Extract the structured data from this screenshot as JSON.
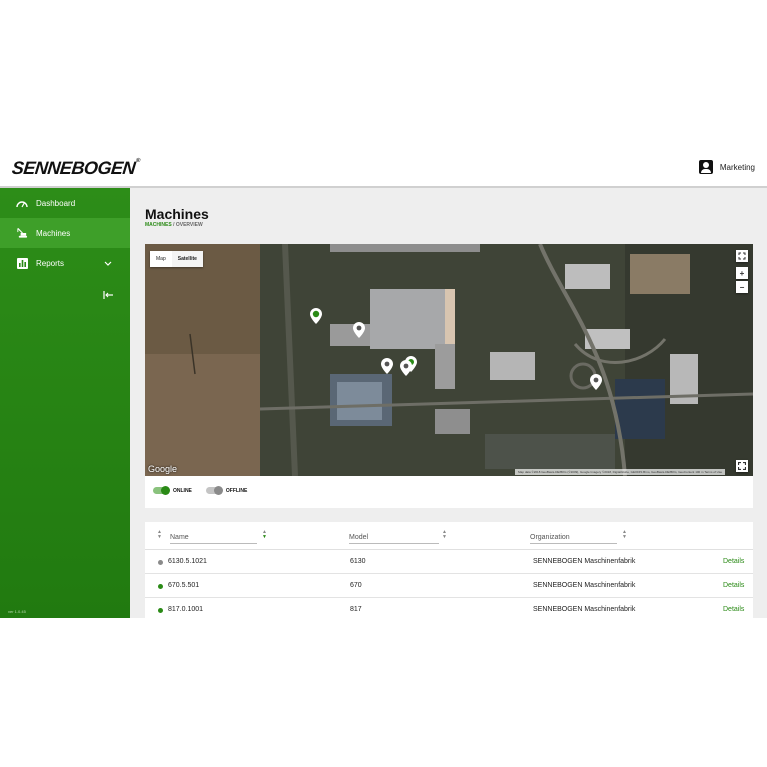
{
  "brand": {
    "logo_text": "SENNEBOGEN"
  },
  "user": {
    "name": "Marketing",
    "icon": "user-account-icon"
  },
  "sidebar": {
    "items": [
      {
        "label": "Dashboard",
        "icon": "dashboard-gauge-icon",
        "active": false
      },
      {
        "label": "Machines",
        "icon": "crane-machine-icon",
        "active": true
      },
      {
        "label": "Reports",
        "icon": "bar-chart-icon",
        "active": false
      }
    ],
    "collapse_icon": "collapse-left-icon",
    "version": "ver 1.0.45"
  },
  "page": {
    "title": "Machines",
    "breadcrumb": {
      "first": "MACHINES",
      "separator": "/",
      "second": "OVERVIEW"
    }
  },
  "map": {
    "types": [
      "Map",
      "Satellite"
    ],
    "selected_type": "Satellite",
    "zoom_in": "+",
    "zoom_out": "−",
    "google_label": "Google",
    "attribution": "Map data ©2018 GeoBasis-DE/BKG (©2009), Google Imagery ©2018, DigitalGlobe, GEODIS Brno, GeoBasis-DE/BKG, GeoContent   100 m   Terms of Use"
  },
  "legend": {
    "online_label": "ONLINE",
    "offline_label": "OFFLINE",
    "online_color": "#2a8a16",
    "offline_color": "#8a8a8a"
  },
  "table": {
    "columns": [
      "Name",
      "Model",
      "Organization"
    ],
    "rows": [
      {
        "name": "6130.5.1021",
        "model": "6130",
        "organization": "SENNEBOGEN Maschinenfabrik",
        "action": "Details",
        "status": "offline"
      },
      {
        "name": "670.5.501",
        "model": "670",
        "organization": "SENNEBOGEN Maschinenfabrik",
        "action": "Details",
        "status": "online"
      },
      {
        "name": "817.0.1001",
        "model": "817",
        "organization": "SENNEBOGEN Maschinenfabrik",
        "action": "Details",
        "status": "online"
      }
    ]
  },
  "colors": {
    "brand_green": "#2a8a16",
    "sidebar_active": "#3e9f29"
  }
}
